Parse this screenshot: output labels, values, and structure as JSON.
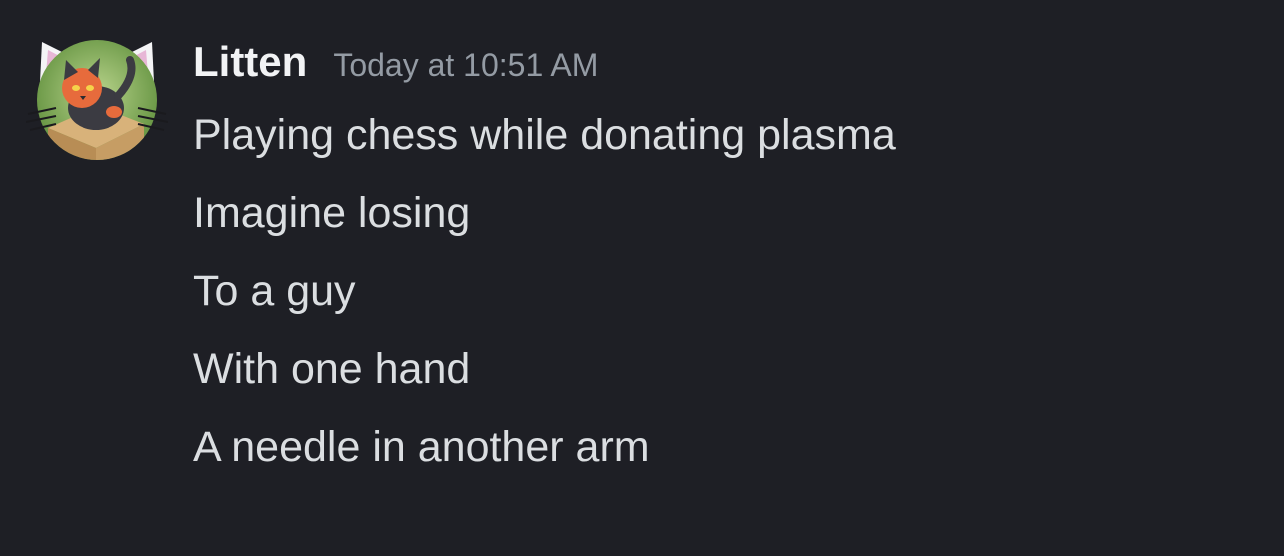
{
  "message": {
    "author": "Litten",
    "timestamp": "Today at 10:51 AM",
    "lines": [
      "Playing chess while donating plasma",
      "Imagine losing",
      "To a guy",
      "With one hand",
      "A needle in another arm"
    ]
  },
  "colors": {
    "background": "#1e1f25",
    "author": "#f2f3f5",
    "timestamp": "#949ba4",
    "message_text": "#dbdee1"
  },
  "icons": {
    "avatar": "litten-cat-avatar-with-ear-decoration"
  }
}
